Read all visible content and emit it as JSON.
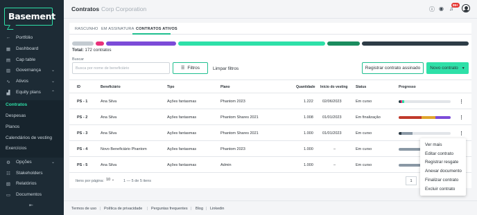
{
  "brand": {
    "logo_text": "Basement"
  },
  "sidebar": {
    "items": [
      {
        "label": "Portfólio",
        "icon": "arrow-left-icon"
      },
      {
        "label": "Dashboard",
        "icon": "grid-icon"
      },
      {
        "label": "Cap table",
        "icon": "table-icon"
      },
      {
        "label": "Governança",
        "icon": "governance-icon"
      },
      {
        "label": "Ativos",
        "icon": "chart-line-icon"
      },
      {
        "label": "Equity plans",
        "icon": "equity-icon"
      },
      {
        "label": "Opções",
        "icon": "options-icon"
      },
      {
        "label": "Stakeholders",
        "icon": "people-icon"
      },
      {
        "label": "Relatórios",
        "icon": "report-icon"
      },
      {
        "label": "Documentos",
        "icon": "document-icon"
      }
    ],
    "subitems": [
      "Contratos",
      "Despesas",
      "Planos",
      "Calendários de vesting",
      "Exercícios"
    ],
    "collapse_icon": "collapse-icon"
  },
  "header": {
    "title": "Contratos",
    "company": "Corp Corporation",
    "notification_badge": "99+"
  },
  "tabs": [
    {
      "label": "RASCUNHO"
    },
    {
      "label": "EM ASSINATURA"
    },
    {
      "label": "CONTRATOS ATIVOS"
    }
  ],
  "status_bar_colors": [
    "#c4cbd1",
    "#e8317a",
    "#7c4bd8",
    "#2ee0a8",
    "#1a8c5e",
    "#2d3c46"
  ],
  "summary": {
    "total_label": "Total:",
    "total_value": "172 contratos"
  },
  "search": {
    "label": "Buscar",
    "placeholder": "Busca por nome de beneficiário"
  },
  "buttons": {
    "filtros": "Filtros",
    "limpar": "Limpar filtros",
    "registrar": "Registrar contrato assinado",
    "novo": "Novo contrato"
  },
  "table": {
    "columns": [
      "ID",
      "Beneficiário",
      "Tipo",
      "Plano",
      "Quantidade",
      "Início do vesting",
      "Status",
      "Progresso"
    ],
    "rows": [
      {
        "id": "PS - 1",
        "beneficiario": "Ana Silva",
        "tipo": "Ações fantasmas",
        "plano": "Phantom 2023",
        "quantidade": "1.222",
        "inicio": "02/06/2023",
        "status": "Em curso"
      },
      {
        "id": "PS - 2",
        "beneficiario": "Ana Silva",
        "tipo": "Ações fantasmas",
        "plano": "Phantom Shares 2021",
        "quantidade": "1.008",
        "inicio": "01/01/2023",
        "status": "Em finalização"
      },
      {
        "id": "PS - 3",
        "beneficiario": "Ana Silva",
        "tipo": "Ações fantasmas",
        "plano": "Phantom Shares 2021",
        "quantidade": "1.000",
        "inicio": "01/01/2023",
        "status": "Em curso"
      },
      {
        "id": "PS - 4",
        "beneficiario": "Novo Beneficiário Phantom",
        "tipo": "Ações fantasmas",
        "plano": "Phantom 2023",
        "quantidade": "1.000",
        "inicio": "–",
        "status": "Em curso"
      },
      {
        "id": "PS - 5",
        "beneficiario": "Ana Silva",
        "tipo": "Ações fantasmas",
        "plano": "Admin",
        "quantidade": "1.000",
        "inicio": "–",
        "status": "Em curso"
      }
    ]
  },
  "pagination": {
    "label": "Itens por página:",
    "per_page": "10",
    "range": "1 — 5 de 5 itens",
    "page": "1"
  },
  "row_menu": [
    "Ver mais",
    "Editar contrato",
    "Registrar resgate",
    "Anexar documento",
    "Finalizar contrato",
    "Excluir contrato"
  ],
  "footer": [
    "Termos de uso",
    "Política de privacidade",
    "Perguntas frequentes",
    "Blog",
    "Linkedin"
  ]
}
